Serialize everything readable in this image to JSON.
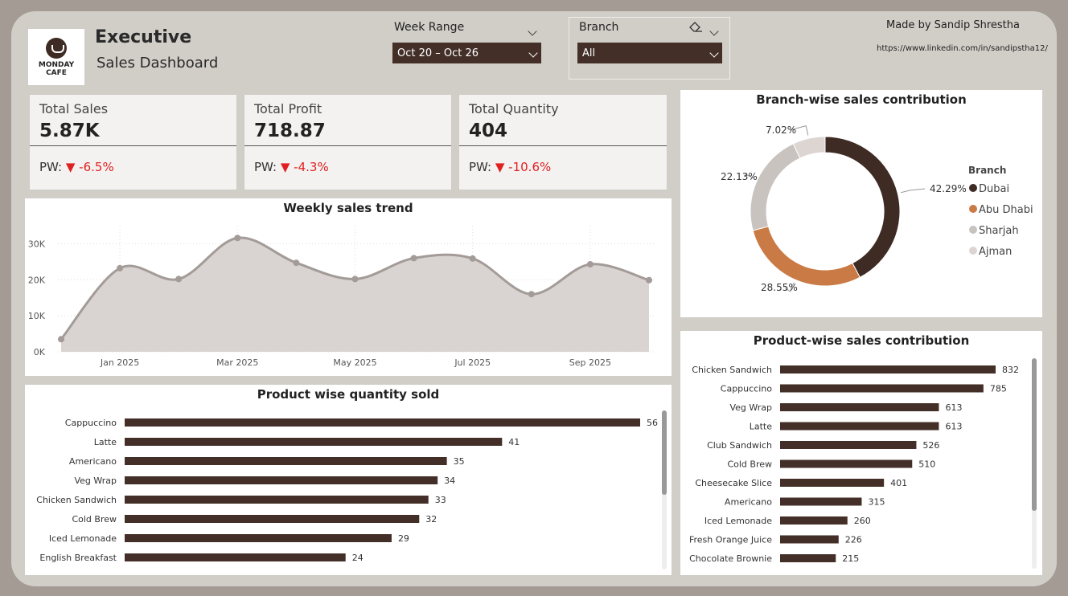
{
  "header": {
    "logo_line1": "MONDAY",
    "logo_line2": "CAFE",
    "title": "Executive",
    "subtitle": "Sales Dashboard",
    "made_by": "Made by Sandip Shrestha",
    "link": "https://www.linkedin.com/in/sandipstha12/"
  },
  "filters": {
    "week_label": "Week Range",
    "week_value": "Oct 20 – Oct 26",
    "branch_label": "Branch",
    "branch_value": "All"
  },
  "kpis": [
    {
      "title": "Total Sales",
      "value": "5.87K",
      "pw_label": "PW:",
      "pw_arrow": "▼",
      "pw_change": "-6.5%"
    },
    {
      "title": "Total Profit",
      "value": "718.87",
      "pw_label": "PW:",
      "pw_arrow": "▼",
      "pw_change": "-4.3%"
    },
    {
      "title": "Total Quantity",
      "value": "404",
      "pw_label": "PW:",
      "pw_arrow": "▼",
      "pw_change": "-10.6%"
    }
  ],
  "colors": {
    "brown": "#432f28",
    "dubai": "#3e2b24",
    "abu_dhabi": "#c97a45",
    "sharjah": "#c8c3bf",
    "ajman": "#ddd5d2",
    "negative": "#e02020",
    "area_fill": "#d9d4d1",
    "line": "#a39b97"
  },
  "chart_data": [
    {
      "type": "area",
      "title": "Weekly sales trend",
      "xlabel": "",
      "ylabel": "",
      "ylim": [
        0,
        35000
      ],
      "y_ticks": [
        "0K",
        "10K",
        "20K",
        "30K"
      ],
      "x_ticks": [
        "Jan 2025",
        "Mar 2025",
        "May 2025",
        "Jul 2025",
        "Sep 2025"
      ],
      "x": [
        "2024-11",
        "2025-01",
        "2025-02",
        "2025-03",
        "2025-04",
        "2025-05",
        "2025-06",
        "2025-07",
        "2025-08",
        "2025-09",
        "2025-10"
      ],
      "values": [
        3500,
        23200,
        20200,
        31600,
        24700,
        20200,
        26000,
        25900,
        16000,
        24300,
        19900
      ]
    },
    {
      "type": "bar",
      "title": "Product wise quantity sold",
      "categories": [
        "Cappuccino",
        "Latte",
        "Americano",
        "Veg Wrap",
        "Chicken Sandwich",
        "Cold Brew",
        "Iced Lemonade",
        "English Breakfast"
      ],
      "values": [
        56,
        41,
        35,
        34,
        33,
        32,
        29,
        24
      ]
    },
    {
      "type": "pie",
      "title": "Branch-wise sales contribution",
      "legend_title": "Branch",
      "categories": [
        "Dubai",
        "Abu Dhabi",
        "Sharjah",
        "Ajman"
      ],
      "values": [
        42.29,
        28.55,
        22.13,
        7.02
      ],
      "labels": [
        "42.29%",
        "28.55%",
        "22.13%",
        "7.02%"
      ]
    },
    {
      "type": "bar",
      "title": "Product-wise sales contribution",
      "categories": [
        "Chicken Sandwich",
        "Cappuccino",
        "Veg Wrap",
        "Latte",
        "Club Sandwich",
        "Cold Brew",
        "Cheesecake Slice",
        "Americano",
        "Iced Lemonade",
        "Fresh Orange Juice",
        "Chocolate Brownie"
      ],
      "values": [
        832,
        785,
        613,
        613,
        526,
        510,
        401,
        315,
        260,
        226,
        215
      ]
    }
  ]
}
